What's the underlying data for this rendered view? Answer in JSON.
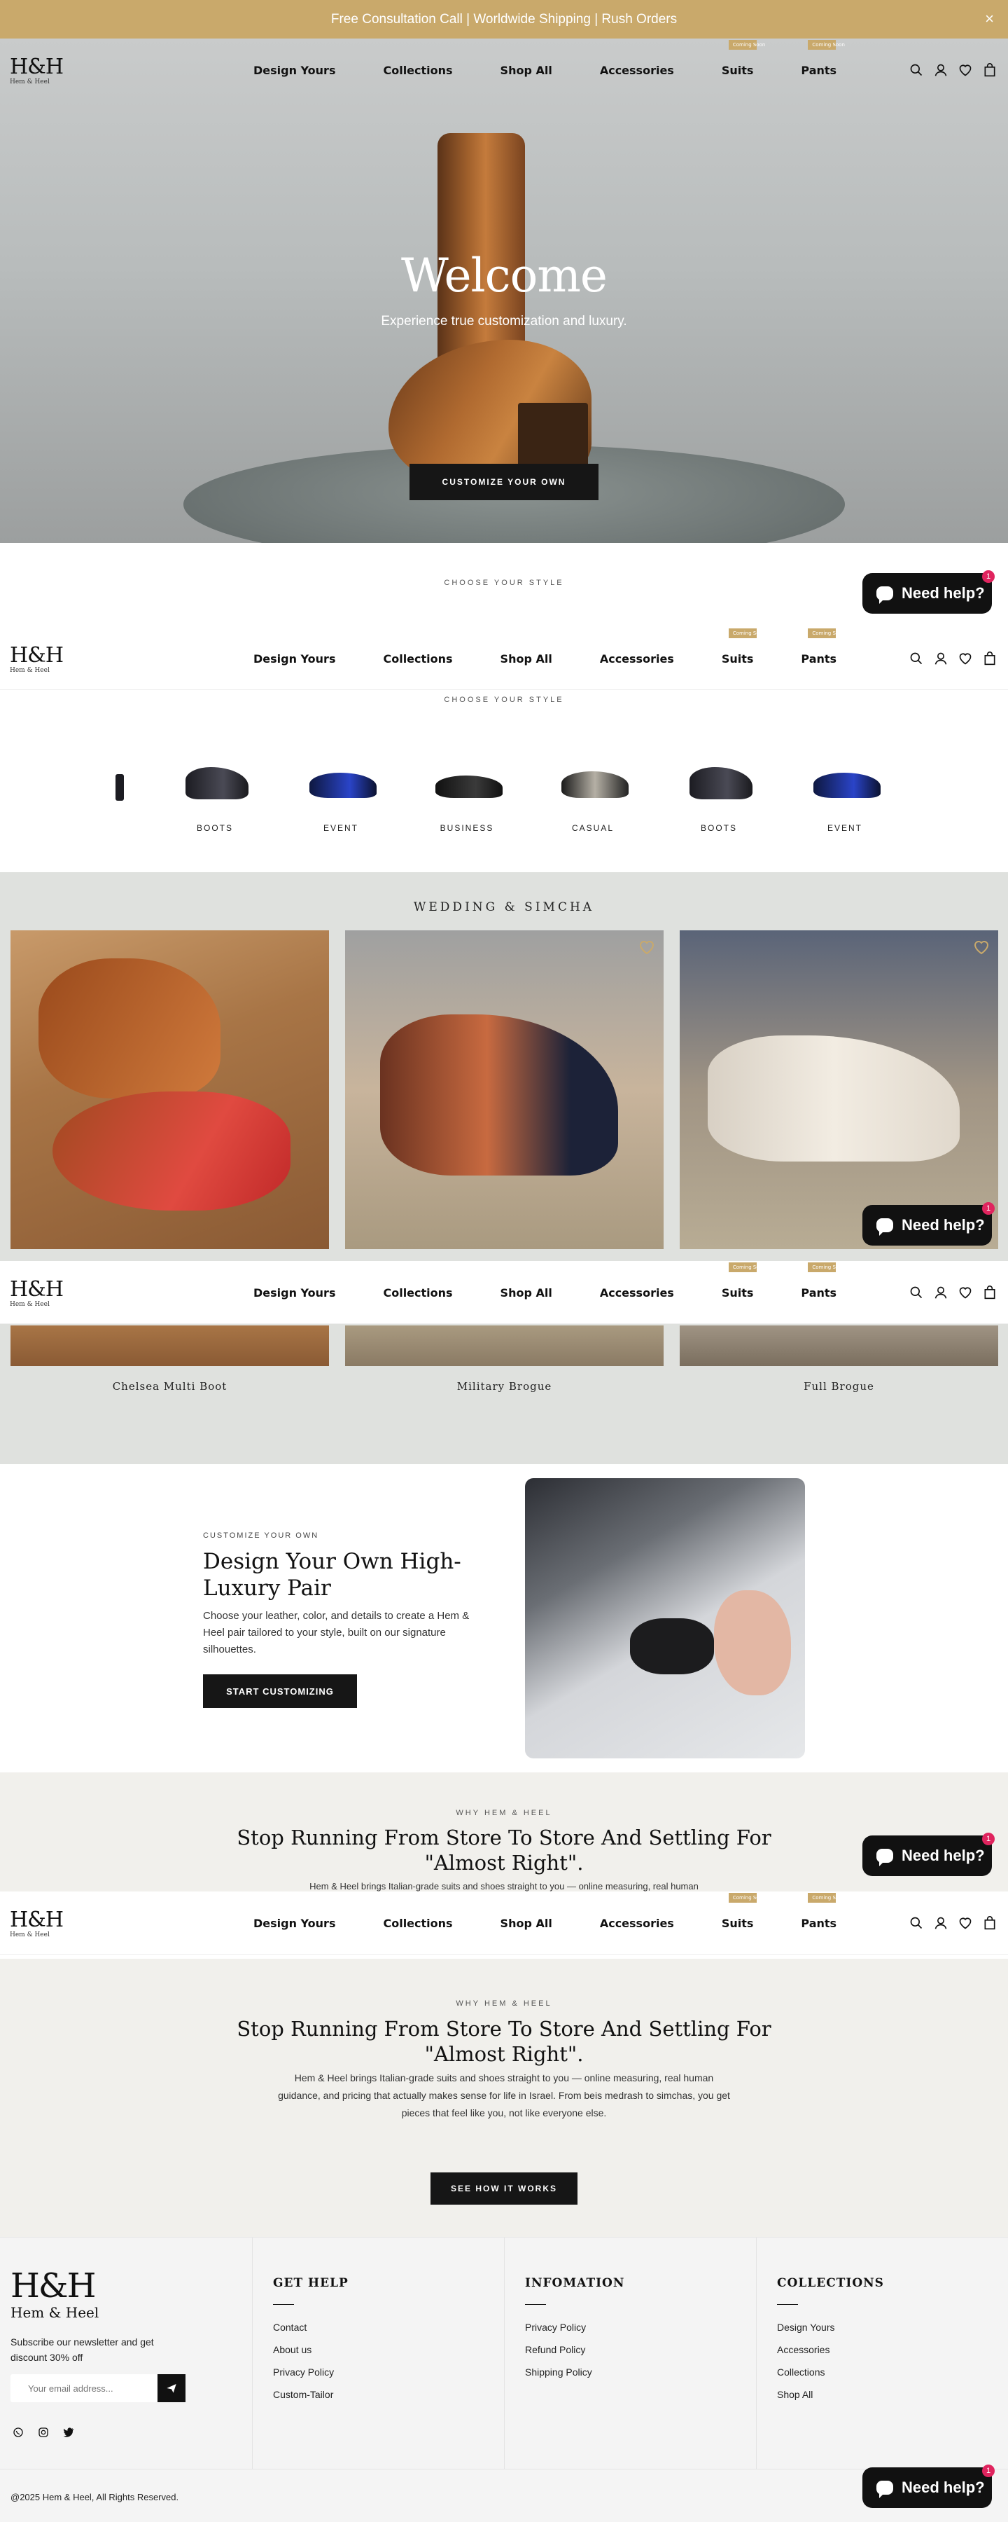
{
  "announcement": {
    "text": "Free Consultation Call | Worldwide Shipping | Rush Orders",
    "close": "×"
  },
  "brand": {
    "logo": "H&H",
    "sub": "Hem & Heel"
  },
  "nav": {
    "items": [
      "Design Yours",
      "Collections",
      "Shop All",
      "Accessories",
      "Suits",
      "Pants"
    ],
    "badge": "Coming Soon"
  },
  "icons": {
    "search": "search-icon",
    "account": "user-icon",
    "wishlist": "heart-icon",
    "cart": "bag-icon",
    "chat": "chat-icon"
  },
  "hero": {
    "title": "Welcome",
    "subtitle": "Experience true customization and luxury.",
    "button": "CUSTOMIZE YOUR OWN"
  },
  "chat": {
    "label": "Need help?",
    "count": "1"
  },
  "styles": {
    "eyebrow": "CHOOSE YOUR STYLE",
    "categories": [
      "BOOTS",
      "EVENT",
      "BUSINESS",
      "CASUAL",
      "BOOTS",
      "EVENT"
    ]
  },
  "wedding": {
    "title": "WEDDING & SIMCHA",
    "products": [
      "Chelsea Multi Boot",
      "Military Brogue",
      "Full Brogue"
    ]
  },
  "design_own": {
    "eyebrow": "CUSTOMIZE YOUR OWN",
    "title": "Design Your Own High-Luxury Pair",
    "body": "Choose your leather, color, and details to create a Hem & Heel pair tailored to your style, built on our signature silhouettes.",
    "button": "START CUSTOMIZING"
  },
  "why": {
    "eyebrow": "WHY HEM & HEEL",
    "title": "Stop Running From Store To Store And Settling For \"Almost Right\".",
    "body_partial": "Hem & Heel brings Italian-grade suits and shoes straight to you — online measuring, real human",
    "body": "Hem & Heel brings Italian-grade suits and shoes straight to you — online measuring, real human guidance, and pricing that actually makes sense for life in Israel. From beis medrash to simchas, you get pieces that feel like you, not like everyone else.",
    "button": "SEE HOW IT WORKS"
  },
  "footer": {
    "newsletter": "Subscribe our newsletter and get discount 30% off",
    "email_placeholder": "Your email address...",
    "social": [
      "whatsapp-icon",
      "instagram-icon",
      "twitter-icon"
    ],
    "columns": [
      {
        "title": "GET HELP",
        "links": [
          "Contact",
          "About us",
          "Privacy Policy",
          "Custom-Tailor"
        ]
      },
      {
        "title": "INFOMATION",
        "links": [
          "Privacy Policy",
          "Refund Policy",
          "Shipping Policy"
        ]
      },
      {
        "title": "COLLECTIONS",
        "links": [
          "Design Yours",
          "Accessories",
          "Collections",
          "Shop All"
        ]
      }
    ],
    "copyright": "@2025 Hem & Heel, All Rights Reserved."
  },
  "colors": {
    "gold": "#c9a96b",
    "dark": "#161616",
    "wedding_bg": "#dfe1de",
    "why_bg": "#f1f0ec",
    "badge_red": "#e0245e"
  }
}
